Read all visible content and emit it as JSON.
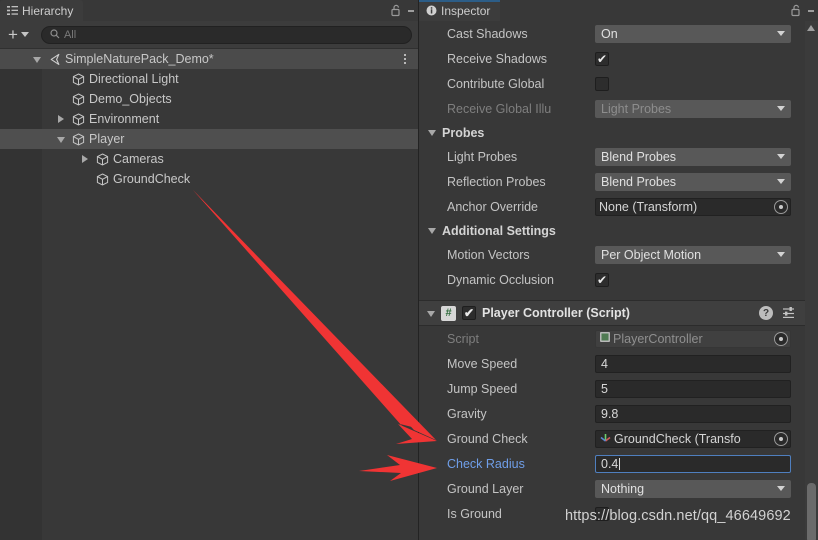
{
  "hierarchy": {
    "tab_label": "Hierarchy",
    "tab_icon": "hierarchy-icon",
    "lock_icon": "lock-open-icon",
    "menu_icon": "kebab-menu-icon",
    "add_label": "+",
    "search_placeholder": "All",
    "search_icon": "search-icon",
    "rows": [
      {
        "label": "SimpleNaturePack_Demo*",
        "icon": "scene-icon",
        "indent": 0,
        "foldout": "down",
        "selected": true,
        "kebab": true
      },
      {
        "label": "Directional Light",
        "icon": "gameobject-cube-icon",
        "indent": 1,
        "foldout": "none",
        "selected": false,
        "kebab": false
      },
      {
        "label": "Demo_Objects",
        "icon": "gameobject-cube-icon",
        "indent": 1,
        "foldout": "none",
        "selected": false,
        "kebab": false
      },
      {
        "label": "Environment",
        "icon": "gameobject-cube-icon",
        "indent": 1,
        "foldout": "right",
        "selected": false,
        "kebab": false
      },
      {
        "label": "Player",
        "icon": "gameobject-cube-icon",
        "indent": 1,
        "foldout": "down",
        "selected": true,
        "kebab": false
      },
      {
        "label": "Cameras",
        "icon": "gameobject-cube-icon",
        "indent": 2,
        "foldout": "right",
        "selected": false,
        "kebab": false
      },
      {
        "label": "GroundCheck",
        "icon": "gameobject-cube-icon",
        "indent": 2,
        "foldout": "none",
        "selected": false,
        "kebab": false
      }
    ]
  },
  "inspector": {
    "tab_label": "Inspector",
    "tab_icon": "info-icon",
    "lock_icon": "lock-open-icon",
    "menu_icon": "kebab-menu-icon",
    "accent_color": "#2c5d87",
    "renderer_rows": [
      {
        "label": "Cast Shadows",
        "type": "dropdown",
        "value": "On",
        "dim": false
      },
      {
        "label": "Receive Shadows",
        "type": "checkbox",
        "value": "checked",
        "dim": false
      },
      {
        "label": "Contribute Global",
        "type": "checkbox",
        "value": "unchecked",
        "dim": false
      },
      {
        "label": "Receive Global Illu",
        "type": "dropdown",
        "value": "Light Probes",
        "dim": true
      }
    ],
    "probes_section": {
      "title": "Probes",
      "rows": [
        {
          "label": "Light Probes",
          "type": "dropdown",
          "value": "Blend Probes",
          "dim": false
        },
        {
          "label": "Reflection Probes",
          "type": "dropdown",
          "value": "Blend Probes",
          "dim": false
        },
        {
          "label": "Anchor Override",
          "type": "objectfield",
          "value": "None (Transform)",
          "dim": false,
          "icon": ""
        }
      ]
    },
    "additional_section": {
      "title": "Additional Settings",
      "rows": [
        {
          "label": "Motion Vectors",
          "type": "dropdown",
          "value": "Per Object Motion",
          "dim": false
        },
        {
          "label": "Dynamic Occlusion",
          "type": "checkbox",
          "value": "checked",
          "dim": false
        }
      ]
    },
    "player_controller": {
      "title": "Player Controller (Script)",
      "enabled": "checked",
      "script_badge": "csharp-script-icon",
      "foldout": "down",
      "help_icon": "help-icon",
      "preset_icon": "preset-icon",
      "menu_icon": "kebab-menu-icon",
      "rows": [
        {
          "label": "Script",
          "type": "objectfield",
          "value": "PlayerController",
          "dim": true,
          "icon": "script-asset-icon",
          "label_style": "dim"
        },
        {
          "label": "Move Speed",
          "type": "number",
          "value": "4",
          "dim": false,
          "label_style": "normal"
        },
        {
          "label": "Jump Speed",
          "type": "number",
          "value": "5",
          "dim": false,
          "label_style": "normal"
        },
        {
          "label": "Gravity",
          "type": "number",
          "value": "9.8",
          "dim": false,
          "label_style": "normal"
        },
        {
          "label": "Ground Check",
          "type": "objectfield",
          "value": "GroundCheck (Transfo",
          "dim": false,
          "icon": "transform-icon",
          "label_style": "normal"
        },
        {
          "label": "Check Radius",
          "type": "number",
          "value": "0.4",
          "dim": false,
          "focused": true,
          "label_style": "blue"
        },
        {
          "label": "Ground Layer",
          "type": "dropdown",
          "value": "Nothing",
          "dim": false,
          "label_style": "normal"
        },
        {
          "label": "Is Ground",
          "type": "checkbox",
          "value": "unchecked",
          "dim": false,
          "label_style": "normal"
        }
      ]
    },
    "scrollbar": {
      "up_arrow_icon": "scroll-up-arrow-icon",
      "thumb": "scrollbar-thumb"
    }
  },
  "annotations": {
    "arrow_color": "#f03434",
    "arrows": [
      {
        "name": "arrow-groundcheck-to-ground-check-field"
      },
      {
        "name": "arrow-to-check-radius"
      }
    ]
  },
  "watermark": {
    "text": "https://blog.csdn.net/qq_46649692"
  }
}
